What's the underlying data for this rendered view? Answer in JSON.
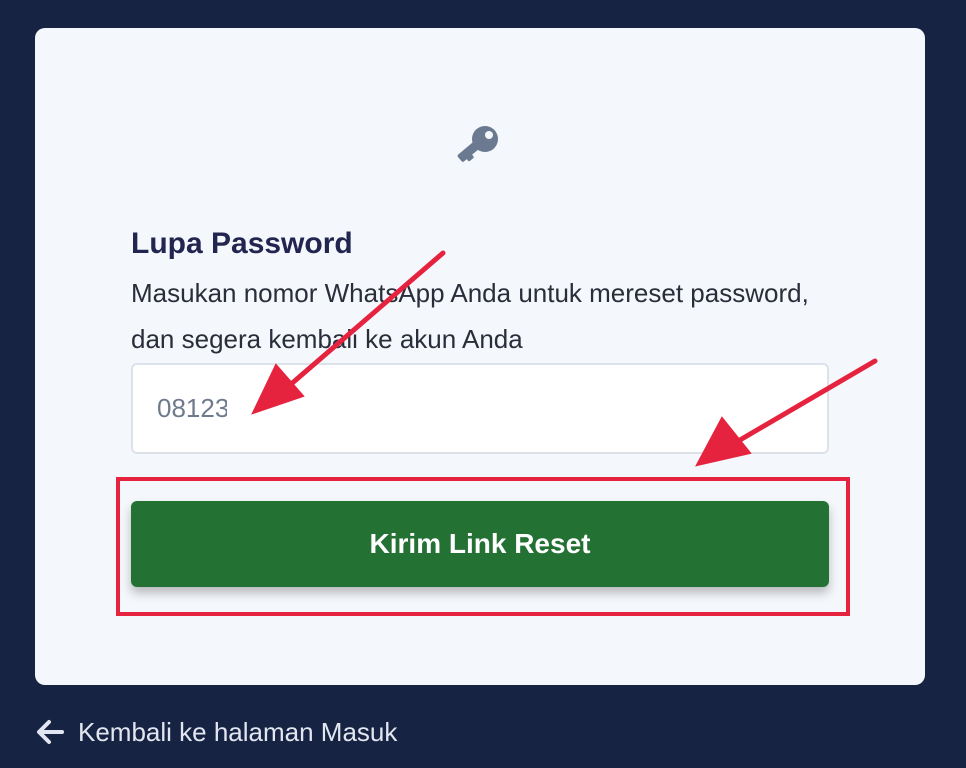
{
  "form": {
    "title": "Lupa Password",
    "description": "Masukan nomor WhatsApp Anda untuk mereset password, dan segera kembali ke akun Anda",
    "phone_value": "08123",
    "submit_label": "Kirim Link Reset"
  },
  "footer": {
    "back_label": "Kembali ke halaman Masuk"
  },
  "icons": {
    "header": "key-icon",
    "back": "arrow-left-icon"
  },
  "colors": {
    "page_background": "#172342",
    "card_background": "#f4f7fb",
    "title": "#22254f",
    "button": "#237133",
    "annotation": "#e6233f",
    "icon": "#6b7a90"
  }
}
